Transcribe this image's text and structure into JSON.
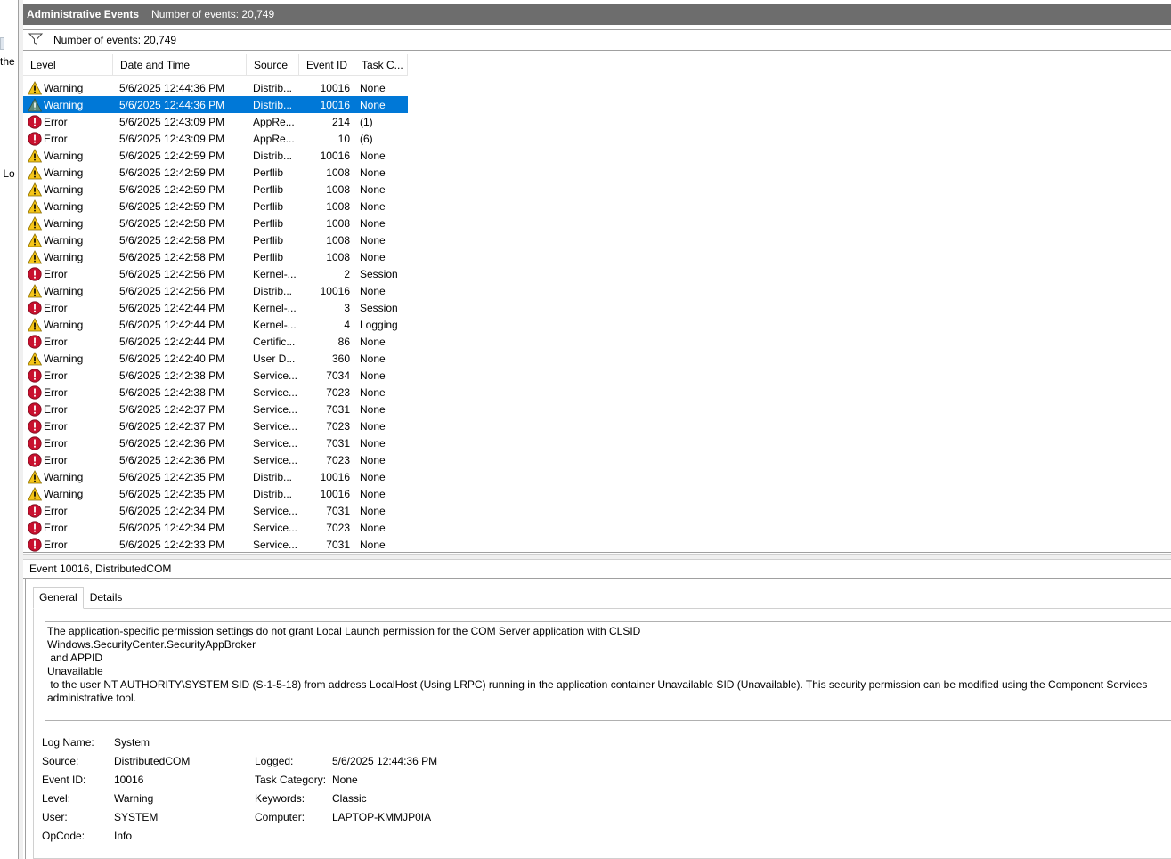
{
  "left_pane": {
    "fragments": [
      "the",
      "s Lo"
    ]
  },
  "title_bar": {
    "title": "Administrative Events",
    "count": "Number of events: 20,749"
  },
  "filter_bar": {
    "icon": "filter-icon",
    "count": "Number of events: 20,749"
  },
  "list": {
    "columns": [
      "Level",
      "Date and Time",
      "Source",
      "Event ID",
      "Task C..."
    ],
    "selected_index": 1,
    "rows": [
      {
        "level": "Warning",
        "date": "5/6/2025 12:44:36 PM",
        "source": "Distrib...",
        "id": "10016",
        "task": "None"
      },
      {
        "level": "Warning",
        "date": "5/6/2025 12:44:36 PM",
        "source": "Distrib...",
        "id": "10016",
        "task": "None"
      },
      {
        "level": "Error",
        "date": "5/6/2025 12:43:09 PM",
        "source": "AppRe...",
        "id": "214",
        "task": "(1)"
      },
      {
        "level": "Error",
        "date": "5/6/2025 12:43:09 PM",
        "source": "AppRe...",
        "id": "10",
        "task": "(6)"
      },
      {
        "level": "Warning",
        "date": "5/6/2025 12:42:59 PM",
        "source": "Distrib...",
        "id": "10016",
        "task": "None"
      },
      {
        "level": "Warning",
        "date": "5/6/2025 12:42:59 PM",
        "source": "Perflib",
        "id": "1008",
        "task": "None"
      },
      {
        "level": "Warning",
        "date": "5/6/2025 12:42:59 PM",
        "source": "Perflib",
        "id": "1008",
        "task": "None"
      },
      {
        "level": "Warning",
        "date": "5/6/2025 12:42:59 PM",
        "source": "Perflib",
        "id": "1008",
        "task": "None"
      },
      {
        "level": "Warning",
        "date": "5/6/2025 12:42:58 PM",
        "source": "Perflib",
        "id": "1008",
        "task": "None"
      },
      {
        "level": "Warning",
        "date": "5/6/2025 12:42:58 PM",
        "source": "Perflib",
        "id": "1008",
        "task": "None"
      },
      {
        "level": "Warning",
        "date": "5/6/2025 12:42:58 PM",
        "source": "Perflib",
        "id": "1008",
        "task": "None"
      },
      {
        "level": "Error",
        "date": "5/6/2025 12:42:56 PM",
        "source": "Kernel-...",
        "id": "2",
        "task": "Session"
      },
      {
        "level": "Warning",
        "date": "5/6/2025 12:42:56 PM",
        "source": "Distrib...",
        "id": "10016",
        "task": "None"
      },
      {
        "level": "Error",
        "date": "5/6/2025 12:42:44 PM",
        "source": "Kernel-...",
        "id": "3",
        "task": "Session"
      },
      {
        "level": "Warning",
        "date": "5/6/2025 12:42:44 PM",
        "source": "Kernel-...",
        "id": "4",
        "task": "Logging"
      },
      {
        "level": "Error",
        "date": "5/6/2025 12:42:44 PM",
        "source": "Certific...",
        "id": "86",
        "task": "None"
      },
      {
        "level": "Warning",
        "date": "5/6/2025 12:42:40 PM",
        "source": "User D...",
        "id": "360",
        "task": "None"
      },
      {
        "level": "Error",
        "date": "5/6/2025 12:42:38 PM",
        "source": "Service...",
        "id": "7034",
        "task": "None"
      },
      {
        "level": "Error",
        "date": "5/6/2025 12:42:38 PM",
        "source": "Service...",
        "id": "7023",
        "task": "None"
      },
      {
        "level": "Error",
        "date": "5/6/2025 12:42:37 PM",
        "source": "Service...",
        "id": "7031",
        "task": "None"
      },
      {
        "level": "Error",
        "date": "5/6/2025 12:42:37 PM",
        "source": "Service...",
        "id": "7023",
        "task": "None"
      },
      {
        "level": "Error",
        "date": "5/6/2025 12:42:36 PM",
        "source": "Service...",
        "id": "7031",
        "task": "None"
      },
      {
        "level": "Error",
        "date": "5/6/2025 12:42:36 PM",
        "source": "Service...",
        "id": "7023",
        "task": "None"
      },
      {
        "level": "Warning",
        "date": "5/6/2025 12:42:35 PM",
        "source": "Distrib...",
        "id": "10016",
        "task": "None"
      },
      {
        "level": "Warning",
        "date": "5/6/2025 12:42:35 PM",
        "source": "Distrib...",
        "id": "10016",
        "task": "None"
      },
      {
        "level": "Error",
        "date": "5/6/2025 12:42:34 PM",
        "source": "Service...",
        "id": "7031",
        "task": "None"
      },
      {
        "level": "Error",
        "date": "5/6/2025 12:42:34 PM",
        "source": "Service...",
        "id": "7023",
        "task": "None"
      },
      {
        "level": "Error",
        "date": "5/6/2025 12:42:33 PM",
        "source": "Service...",
        "id": "7031",
        "task": "None"
      }
    ]
  },
  "detail": {
    "header": "Event 10016, DistributedCOM",
    "tabs": [
      "General",
      "Details"
    ],
    "description": "The application-specific permission settings do not grant Local Launch permission for the COM Server application with CLSID \nWindows.SecurityCenter.SecurityAppBroker\n and APPID \nUnavailable\n to the user NT AUTHORITY\\SYSTEM SID (S-1-5-18) from address LocalHost (Using LRPC) running in the application container Unavailable SID (Unavailable). This security permission can be modified using the Component Services administrative tool.",
    "props": {
      "log_name_label": "Log Name:",
      "log_name": "System",
      "source_label": "Source:",
      "source": "DistributedCOM",
      "logged_label": "Logged:",
      "logged": "5/6/2025 12:44:36 PM",
      "event_id_label": "Event ID:",
      "event_id": "10016",
      "task_category_label": "Task Category:",
      "task_category": "None",
      "level_label": "Level:",
      "level": "Warning",
      "keywords_label": "Keywords:",
      "keywords": "Classic",
      "user_label": "User:",
      "user": "SYSTEM",
      "computer_label": "Computer:",
      "computer": "LAPTOP-KMMJP0IA",
      "opcode_label": "OpCode:",
      "opcode": "Info"
    }
  },
  "colors": {
    "selection": "#0078d7",
    "title_bar": "#6d6d6d",
    "warning": "#f5c518",
    "error": "#c8102e"
  }
}
